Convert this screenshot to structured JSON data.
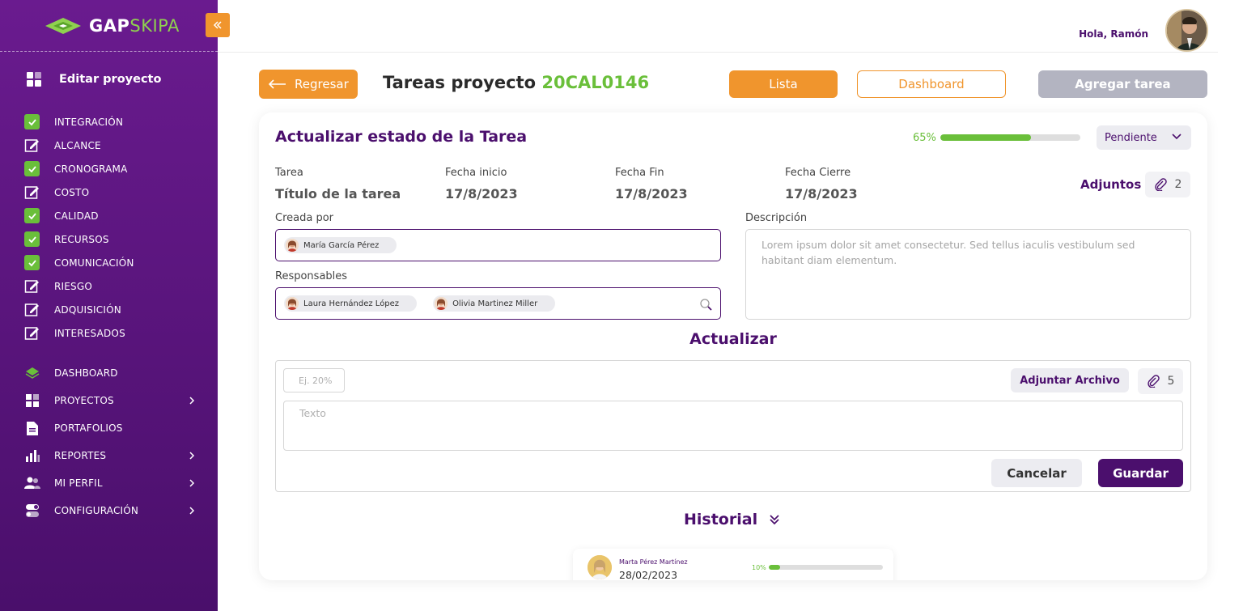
{
  "brand": {
    "name_part1": "GAP",
    "name_part2": "SKIPA"
  },
  "sidebar": {
    "edit_project_label": "Editar proyecto",
    "phases": [
      {
        "label": "INTEGRACIÓN",
        "status": "checked"
      },
      {
        "label": "ALCANCE",
        "status": "edit"
      },
      {
        "label": "CRONOGRAMA",
        "status": "checked"
      },
      {
        "label": "COSTO",
        "status": "edit"
      },
      {
        "label": "CALIDAD",
        "status": "checked"
      },
      {
        "label": "RECURSOS",
        "status": "checked"
      },
      {
        "label": "COMUNICACIÓN",
        "status": "checked"
      },
      {
        "label": "RIESGO",
        "status": "edit"
      },
      {
        "label": "ADQUISICIÓN",
        "status": "edit"
      },
      {
        "label": "INTERESADOS",
        "status": "edit"
      }
    ],
    "nav": [
      {
        "label": "DASHBOARD",
        "icon": "layers-icon",
        "has_children": false
      },
      {
        "label": "PROYECTOS",
        "icon": "grid-icon",
        "has_children": true
      },
      {
        "label": "PORTAFOLIOS",
        "icon": "document-icon",
        "has_children": false
      },
      {
        "label": "REPORTES",
        "icon": "bar-chart-icon",
        "has_children": true
      },
      {
        "label": "MI PERFIL",
        "icon": "users-icon",
        "has_children": true
      },
      {
        "label": "CONFIGURACIÓN",
        "icon": "toggle-icon",
        "has_children": true
      }
    ]
  },
  "header": {
    "greeting": "Hola, Ramón"
  },
  "toolbar": {
    "back_label": "Regresar",
    "title_prefix": "Tareas proyecto",
    "project_code": "20CAL0146",
    "list_label": "Lista",
    "dashboard_label": "Dashboard",
    "add_task_label": "Agregar tarea"
  },
  "task": {
    "card_title": "Actualizar estado de la  Tarea",
    "progress_label": "65%",
    "progress_value": 0.65,
    "status": "Pendiente",
    "fields": {
      "task_label": "Tarea",
      "task_value": "Título de la tarea",
      "start_label": "Fecha inicio",
      "start_value": "17/8/2023",
      "end_label": "Fecha Fin",
      "end_value": "17/8/2023",
      "close_label": "Fecha Cierre",
      "close_value": "17/8/2023"
    },
    "attachments_label": "Adjuntos",
    "attachments_count": "2",
    "created_by_label": "Creada por",
    "created_by": "María García Pérez",
    "responsibles_label": "Responsables",
    "responsibles": [
      "Laura Hernández López",
      "Olivia Martinez Miller"
    ],
    "description_label": "Descripción",
    "description": "Lorem ipsum dolor sit amet consectetur. Sed tellus iaculis vestibulum sed habitant diam elementum."
  },
  "update": {
    "title": "Actualizar",
    "pct_placeholder": "Ej. 20%",
    "attach_label": "Adjuntar Archivo",
    "attach_count": "5",
    "text_placeholder": "Texto",
    "cancel_label": "Cancelar",
    "save_label": "Guardar"
  },
  "history": {
    "title": "Historial",
    "entries": [
      {
        "name": "Marta Pérez Martínez",
        "date": "28/02/2023",
        "progress_label": "10%",
        "progress_value": 0.1
      }
    ]
  },
  "colors": {
    "primary": "#4b0f6d",
    "accent": "#f0952d",
    "success": "#6abf3a",
    "disabled": "#b3b4c1"
  }
}
